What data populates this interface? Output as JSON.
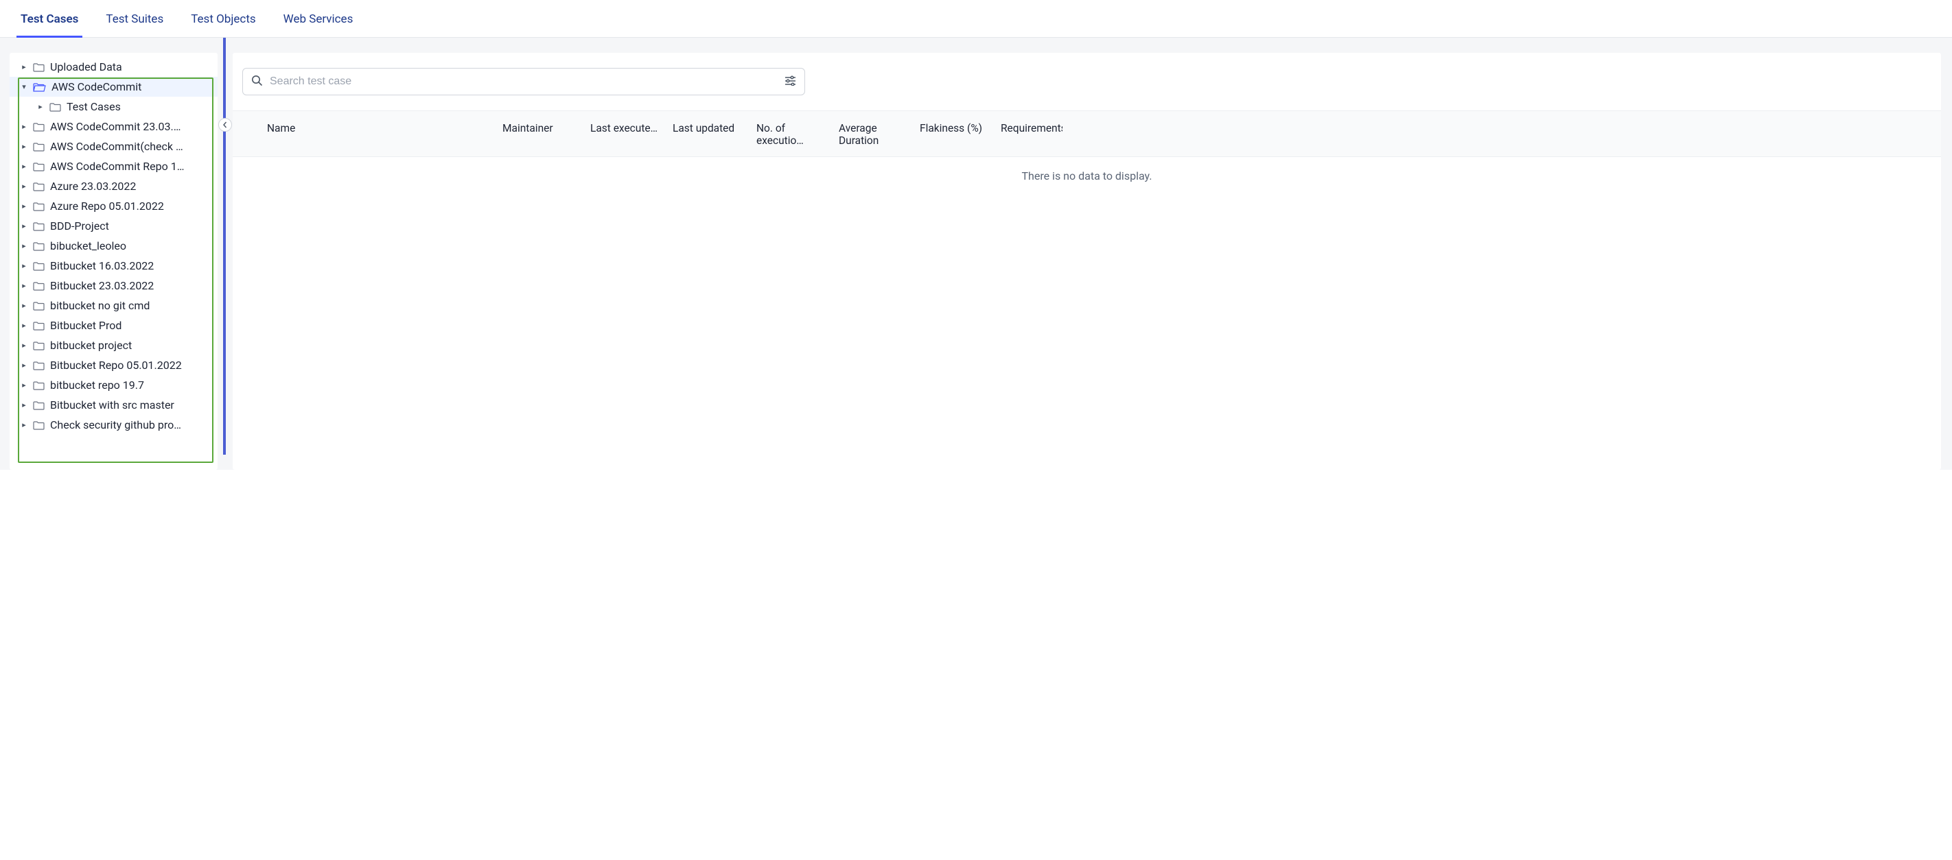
{
  "tabs": [
    {
      "label": "Test Cases",
      "active": true
    },
    {
      "label": "Test Suites",
      "active": false
    },
    {
      "label": "Test Objects",
      "active": false
    },
    {
      "label": "Web Services",
      "active": false
    }
  ],
  "tree": {
    "top_item": {
      "label": "Uploaded Data"
    },
    "selected_item": {
      "label": "AWS CodeCommit"
    },
    "child_item": {
      "label": "Test Cases"
    },
    "items": [
      {
        "label": "AWS CodeCommit 23.03.…"
      },
      {
        "label": "AWS CodeCommit(check …"
      },
      {
        "label": "AWS CodeCommit Repo 1…"
      },
      {
        "label": "Azure 23.03.2022"
      },
      {
        "label": "Azure Repo 05.01.2022"
      },
      {
        "label": "BDD-Project"
      },
      {
        "label": "bibucket_leoleo"
      },
      {
        "label": "Bitbucket 16.03.2022"
      },
      {
        "label": "Bitbucket 23.03.2022"
      },
      {
        "label": "bitbucket no git cmd"
      },
      {
        "label": "Bitbucket Prod"
      },
      {
        "label": "bitbucket project"
      },
      {
        "label": "Bitbucket Repo 05.01.2022"
      },
      {
        "label": "bitbucket repo 19.7"
      },
      {
        "label": "Bitbucket with src master"
      },
      {
        "label": "Check security github pro…"
      }
    ]
  },
  "search": {
    "placeholder": "Search test case"
  },
  "columns": {
    "name": "Name",
    "maintainer": "Maintainer",
    "last_exec": "Last execute…",
    "last_upd": "Last updated",
    "no_exec": "No. of executio…",
    "avg_dur": "Average Duration",
    "flaky": "Flakiness (%)",
    "req": "Requirements"
  },
  "empty_message": "There is no data to display."
}
